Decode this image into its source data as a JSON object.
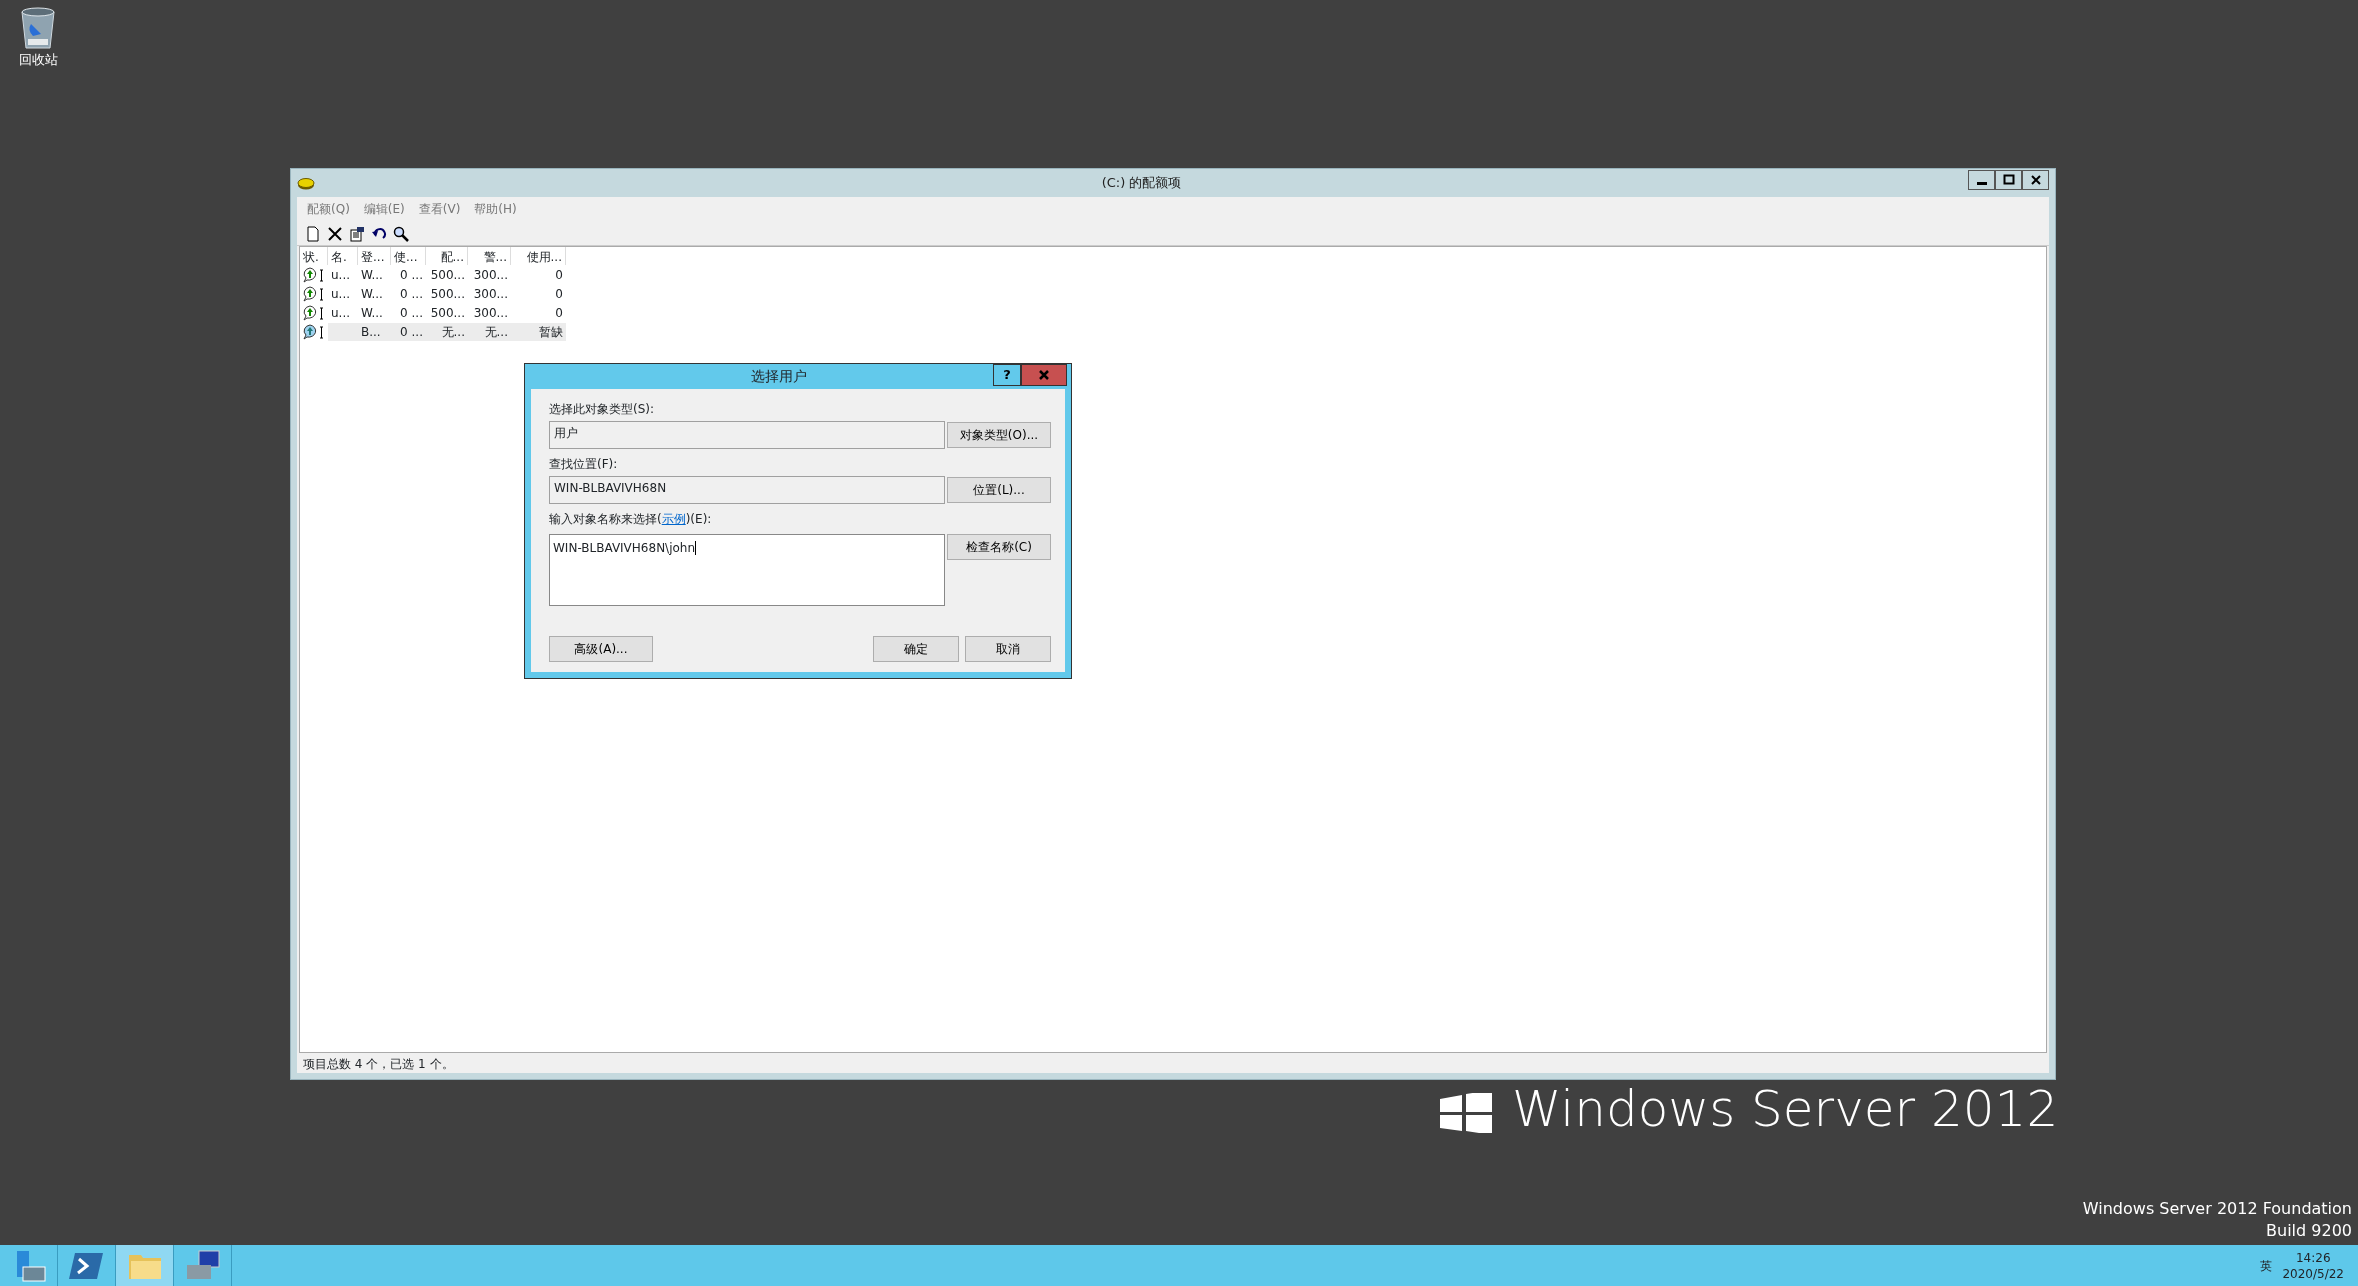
{
  "desktop": {
    "icons": [
      {
        "label": "回收站"
      }
    ],
    "branding": "Windows Server 2012",
    "edition": "Windows Server 2012 Foundation",
    "build": "Build 9200"
  },
  "window": {
    "title": "(C:) 的配额项",
    "menu": [
      "配额(Q)",
      "编辑(E)",
      "查看(V)",
      "帮助(H)"
    ],
    "columns": [
      "状.",
      "名.",
      "登...",
      "使...",
      "配...",
      "警...",
      "使用..."
    ],
    "rows": [
      {
        "kind": "ok",
        "selected": false,
        "cells": [
          "",
          "u...",
          "W...",
          "0 ...",
          "500...",
          "300...",
          "0"
        ]
      },
      {
        "kind": "ok",
        "selected": false,
        "cells": [
          "",
          "u...",
          "W...",
          "0 ...",
          "500...",
          "300...",
          "0"
        ]
      },
      {
        "kind": "ok",
        "selected": false,
        "cells": [
          "",
          "u...",
          "W...",
          "0 ...",
          "500...",
          "300...",
          "0"
        ]
      },
      {
        "kind": "info",
        "selected": true,
        "cells": [
          "",
          "",
          "B...",
          "0 ...",
          "无...",
          "无...",
          "暂缺"
        ]
      }
    ],
    "status_bar": "项目总数 4 个，已选 1 个。"
  },
  "dialog": {
    "title": "选择用户",
    "type_label": "选择此对象类型(S):",
    "type_value": "用户",
    "type_button": "对象类型(O)...",
    "location_label": "查找位置(F):",
    "location_value": "WIN-BLBAVIVH68N",
    "location_button": "位置(L)...",
    "names_label": "输入对象名称来选择(",
    "names_link": "示例",
    "names_label_end": ")(E):",
    "names_value": "WIN-BLBAVIVH68N\\john",
    "check_button": "检查名称(C)",
    "advanced_button": "高级(A)...",
    "ok_button": "确定",
    "cancel_button": "取消",
    "help_button": "?"
  },
  "taskbar": {
    "apps": [
      {
        "kind": "server",
        "selected": false
      },
      {
        "kind": "shell",
        "selected": false
      },
      {
        "kind": "folder",
        "selected": true
      },
      {
        "kind": "toolbox",
        "selected": false
      }
    ],
    "ime": "英",
    "time": "14:26",
    "date": "2020/5/22"
  }
}
